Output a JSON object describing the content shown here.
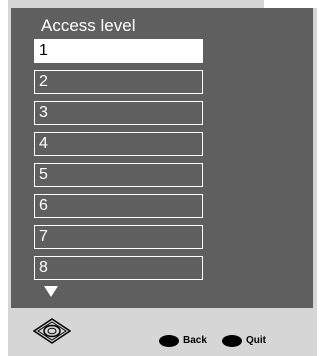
{
  "menu": {
    "title": "Access level",
    "items": [
      {
        "label": "1",
        "selected": true
      },
      {
        "label": "2",
        "selected": false
      },
      {
        "label": "3",
        "selected": false
      },
      {
        "label": "4",
        "selected": false
      },
      {
        "label": "5",
        "selected": false
      },
      {
        "label": "6",
        "selected": false
      },
      {
        "label": "7",
        "selected": false
      },
      {
        "label": "8",
        "selected": false
      }
    ],
    "more_indicator": "down-triangle-icon"
  },
  "footer": {
    "nav_icon": "navigation-pad-icon",
    "back_label": "Back",
    "quit_label": "Quit"
  },
  "colors": {
    "panel": "#5f5f5f",
    "frame": "#d6d6d6",
    "selected_bg": "#ffffff",
    "text": "#ffffff"
  }
}
